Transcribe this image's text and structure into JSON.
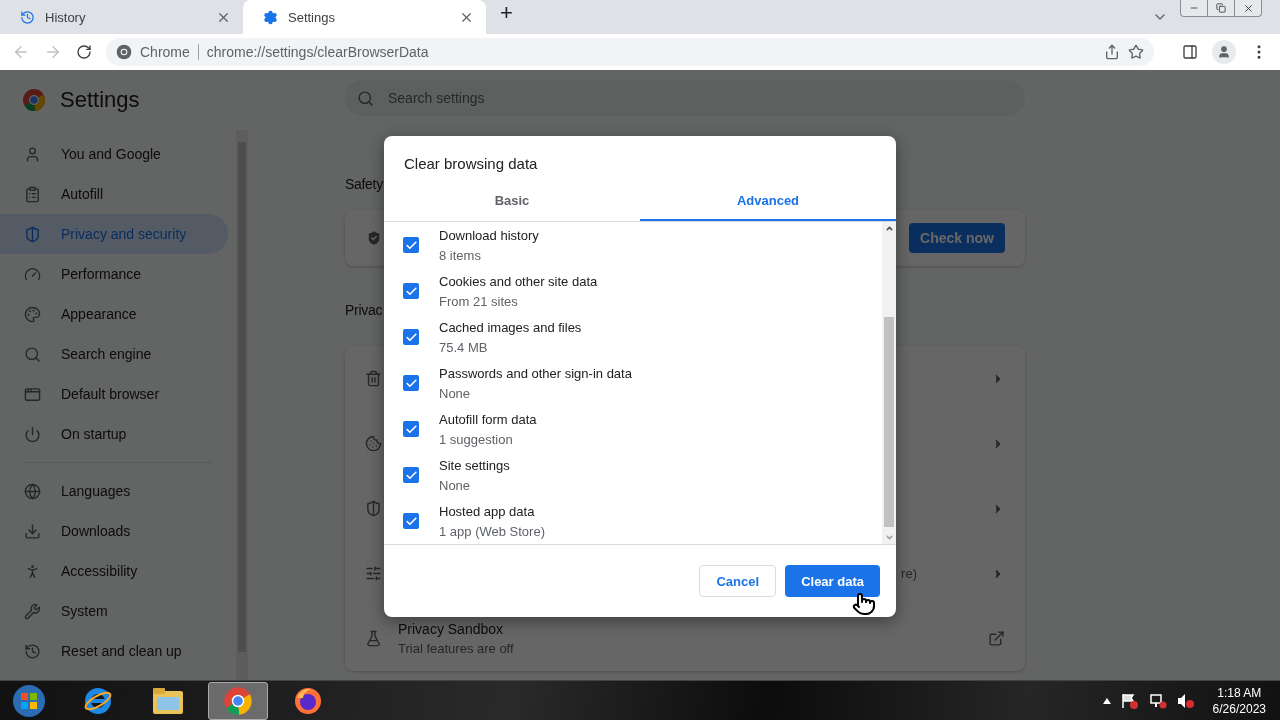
{
  "browser": {
    "tabs": [
      {
        "label": "History",
        "selected": false
      },
      {
        "label": "Settings",
        "selected": true
      }
    ],
    "new_tab": "+",
    "address": {
      "site_label": "Chrome",
      "url": "chrome://settings/clearBrowserData"
    }
  },
  "settings": {
    "title": "Settings",
    "search": {
      "placeholder": "Search settings"
    },
    "sidebar": {
      "groups": [
        [
          {
            "label": "You and Google",
            "selected": false
          },
          {
            "label": "Autofill",
            "selected": false
          },
          {
            "label": "Privacy and security",
            "selected": true
          },
          {
            "label": "Performance",
            "selected": false
          },
          {
            "label": "Appearance",
            "selected": false
          },
          {
            "label": "Search engine",
            "selected": false
          },
          {
            "label": "Default browser",
            "selected": false
          },
          {
            "label": "On startup",
            "selected": false
          }
        ],
        [
          {
            "label": "Languages",
            "selected": false
          },
          {
            "label": "Downloads",
            "selected": false
          },
          {
            "label": "Accessibility",
            "selected": false
          },
          {
            "label": "System",
            "selected": false
          },
          {
            "label": "Reset and clean up",
            "selected": false
          }
        ]
      ]
    },
    "safety_heading": "Safety",
    "safety_button": "Check now",
    "privacy_heading": "Privac",
    "privacy_rows": [
      {
        "kind": "hidden"
      },
      {
        "kind": "hidden"
      },
      {
        "kind": "hidden"
      },
      {
        "kind": "fragment",
        "text": "re)"
      },
      {
        "kind": "full",
        "title": "Privacy Sandbox",
        "subtitle": "Trial features are off"
      }
    ]
  },
  "dialog": {
    "title": "Clear browsing data",
    "tabs": [
      {
        "label": "Basic",
        "selected": false
      },
      {
        "label": "Advanced",
        "selected": true
      }
    ],
    "items": [
      {
        "label": "Download history",
        "detail": "8 items",
        "checked": true
      },
      {
        "label": "Cookies and other site data",
        "detail": "From 21 sites",
        "checked": true
      },
      {
        "label": "Cached images and files",
        "detail": "75.4 MB",
        "checked": true
      },
      {
        "label": "Passwords and other sign-in data",
        "detail": "None",
        "checked": true
      },
      {
        "label": "Autofill form data",
        "detail": "1 suggestion",
        "checked": true
      },
      {
        "label": "Site settings",
        "detail": "None",
        "checked": true
      },
      {
        "label": "Hosted app data",
        "detail": "1 app (Web Store)",
        "checked": true
      }
    ],
    "buttons": [
      {
        "label": "Cancel",
        "kind": "secondary"
      },
      {
        "label": "Clear data",
        "kind": "primary"
      }
    ]
  },
  "taskbar": {
    "apps": [
      {
        "selected": false
      },
      {
        "selected": false
      },
      {
        "selected": true
      },
      {
        "selected": false
      }
    ],
    "time": "1:18 AM",
    "date": "6/26/2023"
  }
}
